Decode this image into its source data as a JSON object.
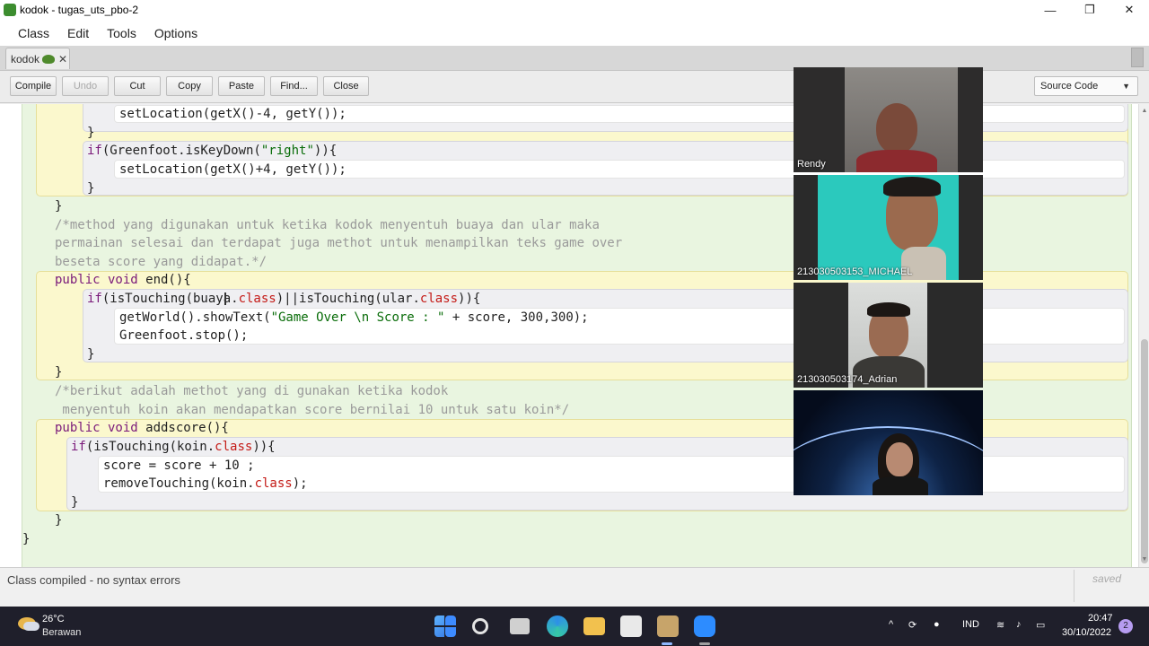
{
  "window": {
    "title": "kodok - tugas_uts_pbo-2",
    "minimize_glyph": "—",
    "maximize_glyph": "❐",
    "close_glyph": "✕"
  },
  "menu": [
    "Class",
    "Edit",
    "Tools",
    "Options"
  ],
  "tab": {
    "label": "kodok",
    "close_glyph": "✕"
  },
  "toolbar": {
    "compile": "Compile",
    "undo": "Undo",
    "cut": "Cut",
    "copy": "Copy",
    "paste": "Paste",
    "find": "Find...",
    "close": "Close",
    "view_mode": "Source Code"
  },
  "code": {
    "l1_pre": "setLocation(getX()-4, getY());",
    "l2": "}",
    "l3_kw": "if",
    "l3_a": "(Greenfoot.isKeyDown(",
    "l3_str": "\"right\"",
    "l3_b": ")){",
    "l4": "setLocation(getX()+4, getY());",
    "l5": "}",
    "l6": "}",
    "c1": "/*method yang digunakan untuk ketika kodok menyentuh buaya dan ular maka",
    "c2": "permainan selesai dan terdapat juga methot untuk menampilkan teks game over",
    "c3": "beseta score yang didapat.*/",
    "m1_kw": "public void",
    "m1_rest": " end(){",
    "if1_kw": "if",
    "if1_a": "(isTouching(buaya.",
    "if1_cls1": "class",
    "if1_b": ")||isTouching(ular.",
    "if1_cls2": "class",
    "if1_c": ")){",
    "s1_a": "getWorld().showText(",
    "s1_str": "\"Game Over \\n Score : \"",
    "s1_b": " + score, 300,300);",
    "s2": "Greenfoot.stop();",
    "if1_close": "}",
    "m1_close": "}",
    "c4": "/*berikut adalah methot yang di gunakan ketika kodok",
    "c5": " menyentuh koin akan mendapatkan score bernilai 10 untuk satu koin*/",
    "m2_kw": "public void",
    "m2_rest": " addscore(){",
    "if2_kw": "if",
    "if2_a": "(isTouching(koin.",
    "if2_cls": "class",
    "if2_b": ")){",
    "s3": "score = score + 10 ;",
    "s4_a": "removeTouching(koin.",
    "s4_cls": "class",
    "s4_b": ");",
    "if2_close": "}",
    "m2_close": "}",
    "class_close": "}"
  },
  "status": {
    "message": "Class compiled - no syntax errors",
    "saved": "saved"
  },
  "participants": [
    {
      "name": "Rendy"
    },
    {
      "name": "213030503153_MICHAEL"
    },
    {
      "name": "213030503174_Adrian"
    },
    {
      "name": ""
    }
  ],
  "taskbar": {
    "temperature": "26°C",
    "weather": "Berawan",
    "language": "IND",
    "time": "20:47",
    "date": "30/10/2022",
    "notifications": "2"
  }
}
